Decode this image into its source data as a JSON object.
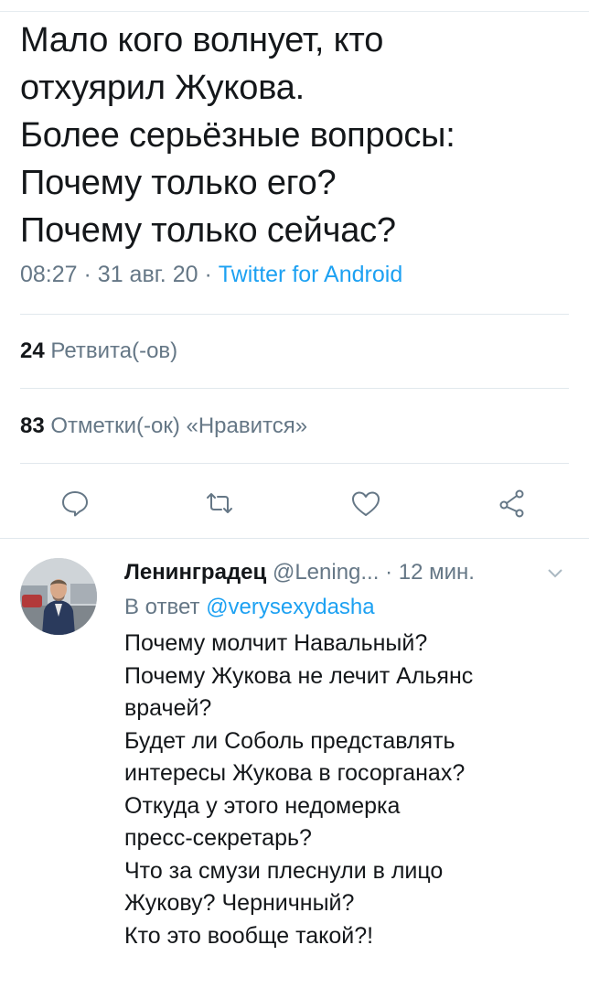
{
  "tweet": {
    "lines": [
      "Мало кого волнует, кто",
      "отхуярил Жукова.",
      "Более серьёзные вопросы:",
      "Почему только его?",
      "Почему только сейчас?"
    ],
    "time": "08:27",
    "date": "31 авг. 20",
    "source": "Twitter for Android",
    "retweets_count": "24",
    "retweets_label": "Ретвита(-ов)",
    "likes_count": "83",
    "likes_label": "Отметки(-ок) «Нравится»"
  },
  "actions": {
    "reply_icon": "comment-icon",
    "retweet_icon": "retweet-icon",
    "like_icon": "heart-icon",
    "share_icon": "share-icon"
  },
  "reply": {
    "name": "Ленинградец",
    "handle": "@Lening...",
    "time": "12 мин.",
    "reply_to_prefix": "В ответ",
    "reply_to_mention": "@verysexydasha",
    "lines": [
      "Почему молчит Навальный?",
      "Почему Жукова не лечит Альянс",
      "врачей?",
      "Будет ли Соболь представлять",
      "интересы Жукова в госорганах?",
      "Откуда у этого недомерка",
      "пресс-секретарь?",
      "Что за смузи плеснули в лицо",
      "Жукову? Черничный?",
      "Кто это вообще такой?!"
    ]
  },
  "colors": {
    "text": "#14171a",
    "secondary": "#657786",
    "accent": "#1da1f2",
    "divider": "#e1e8ed"
  }
}
